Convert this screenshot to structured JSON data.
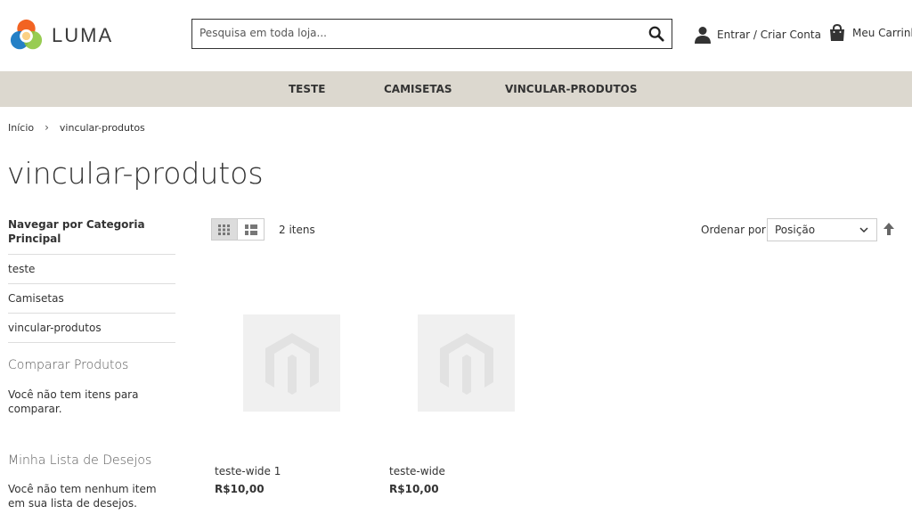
{
  "header": {
    "logo_text": "LUMA",
    "search_placeholder": "Pesquisa em toda loja...",
    "account_label": "Entrar / Criar Conta",
    "cart_label": "Meu Carrinho"
  },
  "nav": {
    "items": [
      {
        "label": "TESTE"
      },
      {
        "label": "CAMISETAS"
      },
      {
        "label": "VINCULAR-PRODUTOS"
      }
    ]
  },
  "breadcrumb": {
    "home": "Início",
    "separator": "›",
    "current": "vincular-produtos"
  },
  "page": {
    "title": "vincular-produtos"
  },
  "sidebar": {
    "category_heading": "Navegar por Categoria Principal",
    "categories": [
      {
        "label": "teste"
      },
      {
        "label": "Camisetas"
      },
      {
        "label": "vincular-produtos"
      }
    ],
    "compare_heading": "Comparar Produtos",
    "compare_note": "Você não tem itens para comparar.",
    "wishlist_heading": "Minha Lista de Desejos",
    "wishlist_note": "Você não tem nenhum item em sua lista de desejos."
  },
  "toolbar": {
    "count": "2 itens",
    "sort_label": "Ordenar por",
    "sort_value": "Posição"
  },
  "products": [
    {
      "name": "teste-wide 1",
      "price": "R$10,00"
    },
    {
      "name": "teste-wide",
      "price": "R$10,00"
    }
  ],
  "colors": {
    "nav_bg": "#dcd8cf",
    "placeholder_bg": "#f0f0f0"
  }
}
